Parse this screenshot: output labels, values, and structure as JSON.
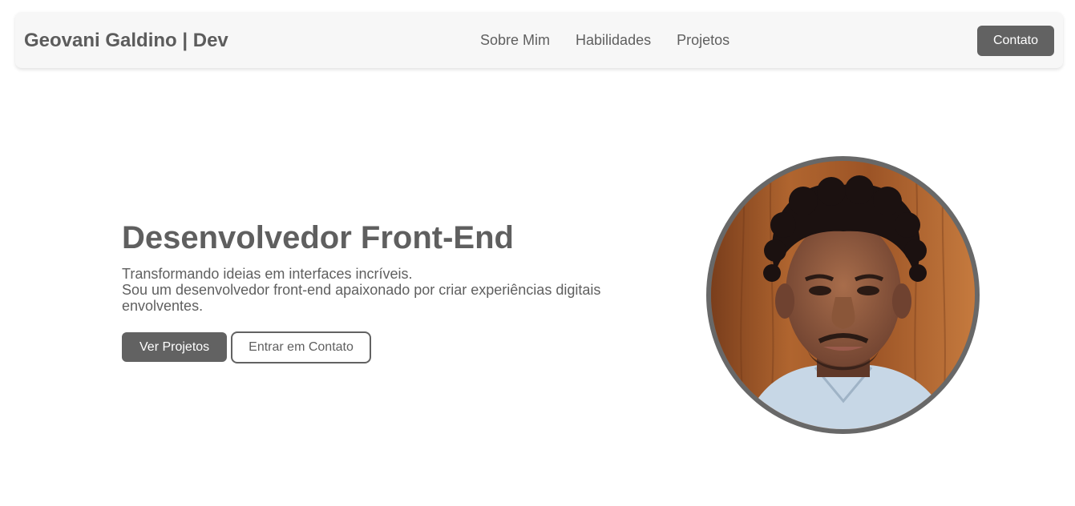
{
  "header": {
    "brand": "Geovani Galdino | Dev",
    "nav": [
      "Sobre Mim",
      "Habilidades",
      "Projetos"
    ],
    "contact_label": "Contato"
  },
  "hero": {
    "title": "Desenvolvedor Front-End",
    "line1": "Transformando ideias em interfaces incríveis.",
    "line2": "Sou um desenvolvedor front-end apaixonado por criar experiências digitais envolventes.",
    "primary_button": "Ver Projetos",
    "secondary_button": "Entrar em Contato"
  },
  "colors": {
    "text": "#5f5f5f",
    "button": "#626262",
    "navbar_bg": "#f7f7f7",
    "avatar_border": "#686868"
  }
}
